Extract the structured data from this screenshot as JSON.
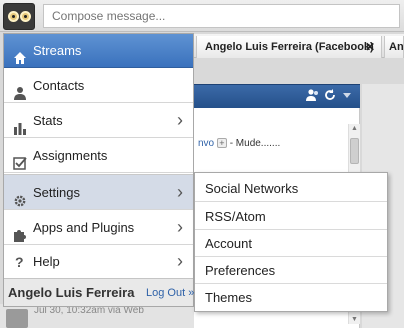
{
  "compose": {
    "placeholder": "Compose message..."
  },
  "tabs": [
    {
      "label": "Angelo Luis Ferreira (Facebook)",
      "close": "✕"
    },
    {
      "label": "An"
    }
  ],
  "column": {
    "snippet_link": "nvo",
    "snippet_text": "- Mude......."
  },
  "footer_post": {
    "timestamp": "Jul 30, 10:32am via Web"
  },
  "menu": {
    "items": [
      {
        "label": "Streams",
        "icon": "home-icon"
      },
      {
        "label": "Contacts",
        "icon": "person-icon"
      },
      {
        "label": "Stats",
        "icon": "bar-chart-icon"
      },
      {
        "label": "Assignments",
        "icon": "checkbox-icon"
      },
      {
        "label": "Settings",
        "icon": "gear-icon"
      },
      {
        "label": "Apps and Plugins",
        "icon": "puzzle-icon"
      },
      {
        "label": "Help",
        "icon": "question-icon"
      }
    ],
    "user_name": "Angelo Luis Ferreira",
    "logout": "Log Out »"
  },
  "submenu": {
    "items": [
      "Social Networks",
      "RSS/Atom",
      "Account",
      "Preferences",
      "Themes"
    ]
  },
  "colors": {
    "active": "#4a80c6",
    "hover": "#d4dbe7",
    "link": "#2f62a8"
  }
}
